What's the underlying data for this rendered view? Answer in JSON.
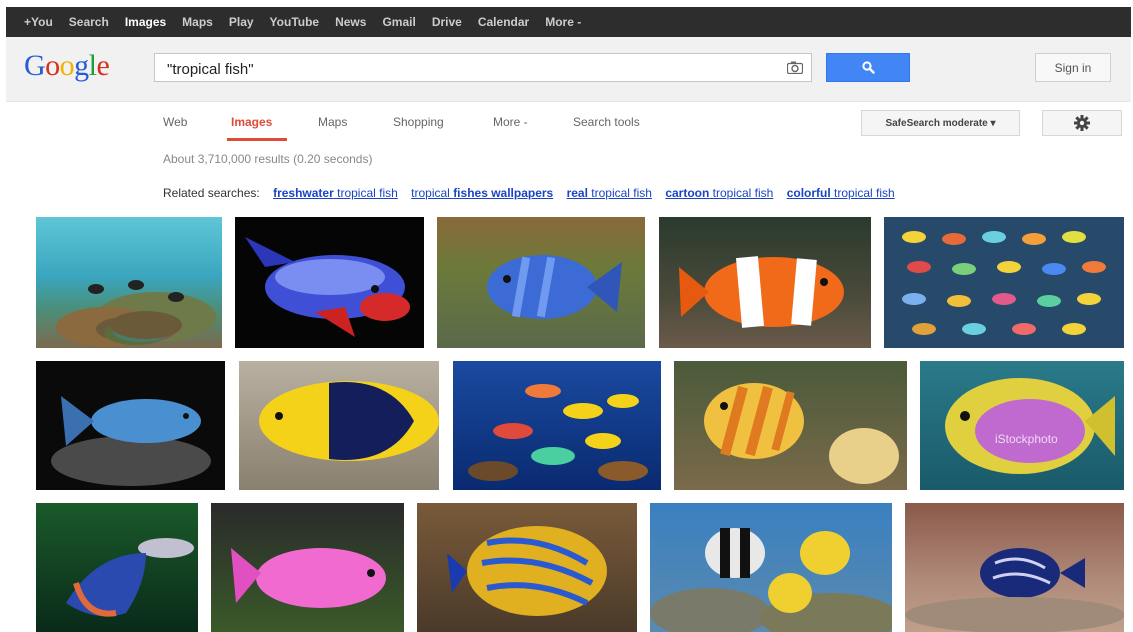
{
  "topbar": {
    "items": [
      "+You",
      "Search",
      "Images",
      "Maps",
      "Play",
      "YouTube",
      "News",
      "Gmail",
      "Drive",
      "Calendar",
      "More -"
    ],
    "active_index": 2
  },
  "header": {
    "logo": [
      "G",
      "o",
      "o",
      "g",
      "l",
      "e"
    ],
    "search_value": "\"tropical fish\"",
    "sign_in": "Sign in"
  },
  "nav": {
    "tabs": [
      "Web",
      "Images",
      "Maps",
      "Shopping",
      "More -",
      "Search tools"
    ],
    "active_index": 1,
    "safesearch": "SafeSearch moderate ▾"
  },
  "results": {
    "count_text": "About 3,710,000 results (0.20 seconds)"
  },
  "related": {
    "label": "Related searches:",
    "links": [
      {
        "bold": "freshwater",
        "rest": " tropical fish"
      },
      {
        "pre": "tropical ",
        "bold": "fishes wallpapers",
        "rest": ""
      },
      {
        "bold": "real",
        "rest": " tropical fish"
      },
      {
        "bold": "cartoon",
        "rest": " tropical fish"
      },
      {
        "bold": "colorful",
        "rest": " tropical fish"
      }
    ]
  },
  "images": {
    "watermark": "iStockphoto",
    "colors": {
      "accent": "#dd4b39",
      "link": "#1a44c6",
      "topbar": "#2d2d2d",
      "search_button": "#4285f4"
    }
  }
}
